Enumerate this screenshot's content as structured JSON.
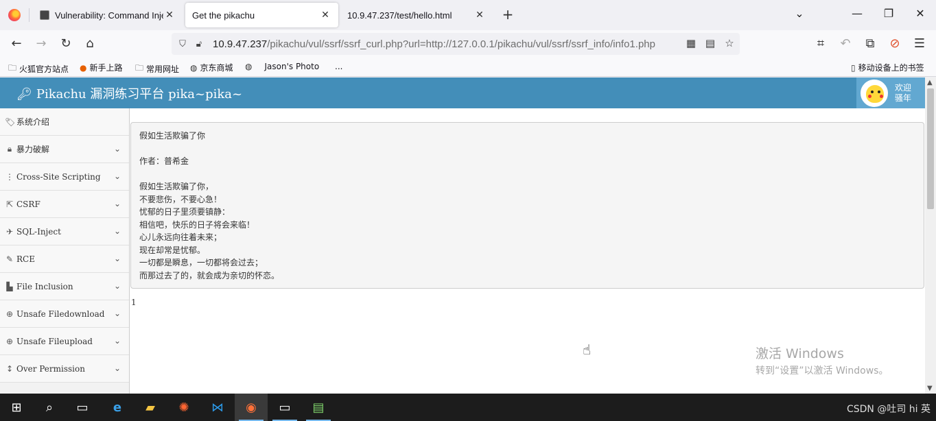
{
  "browser": {
    "tabs": [
      {
        "title": "Vulnerability: Command Injec",
        "active": false
      },
      {
        "title": "Get the pikachu",
        "active": true
      },
      {
        "title": "10.9.47.237/test/hello.html",
        "active": false
      }
    ],
    "url": {
      "host": "10.9.47.237",
      "path": "/pikachu/vul/ssrf/ssrf_curl.php?url=http://127.0.0.1/pikachu/vul/ssrf/ssrf_info/info1.php"
    },
    "bookmarks": [
      "火狐官方站点",
      "新手上路",
      "常用网址",
      "京东商城",
      "Jason's Photo",
      "..."
    ],
    "mobile_bookmarks": "移动设备上的书签"
  },
  "site": {
    "title": "Pikachu 漏洞练习平台 pika~pika~",
    "welcome_line1": "欢迎",
    "welcome_line2": "骚年"
  },
  "sidebar": {
    "items": [
      {
        "label": "系统介绍",
        "icon": "tags-icon",
        "chevron": false
      },
      {
        "label": "暴力破解",
        "icon": "lock-icon",
        "chevron": true
      },
      {
        "label": "Cross-Site Scripting",
        "icon": "list-icon",
        "chevron": true
      },
      {
        "label": "CSRF",
        "icon": "share-icon",
        "chevron": true
      },
      {
        "label": "SQL-Inject",
        "icon": "plane-icon",
        "chevron": true
      },
      {
        "label": "RCE",
        "icon": "pencil-icon",
        "chevron": true
      },
      {
        "label": "File Inclusion",
        "icon": "file-icon",
        "chevron": true
      },
      {
        "label": "Unsafe Filedownload",
        "icon": "download-icon",
        "chevron": true
      },
      {
        "label": "Unsafe Fileupload",
        "icon": "upload-icon",
        "chevron": true
      },
      {
        "label": "Over Permission",
        "icon": "text-height-icon",
        "chevron": true
      }
    ]
  },
  "poem": {
    "lines": [
      "假如生活欺骗了你",
      "",
      "作者：普希金",
      "",
      "假如生活欺骗了你，",
      "不要悲伤，不要心急！",
      "忧郁的日子里须要镇静：",
      "相信吧，快乐的日子将会来临！",
      "心儿永远向往着未来；",
      "现在却常是忧郁。",
      "一切都是瞬息，一切都将会过去；",
      "而那过去了的，就会成为亲切的怀恋。"
    ]
  },
  "result_number": "1",
  "watermark": {
    "line1": "激活 Windows",
    "line2": "转到“设置”以激活 Windows。"
  },
  "taskbar": {
    "tray_text": "CSDN @吐司 hi 英"
  }
}
